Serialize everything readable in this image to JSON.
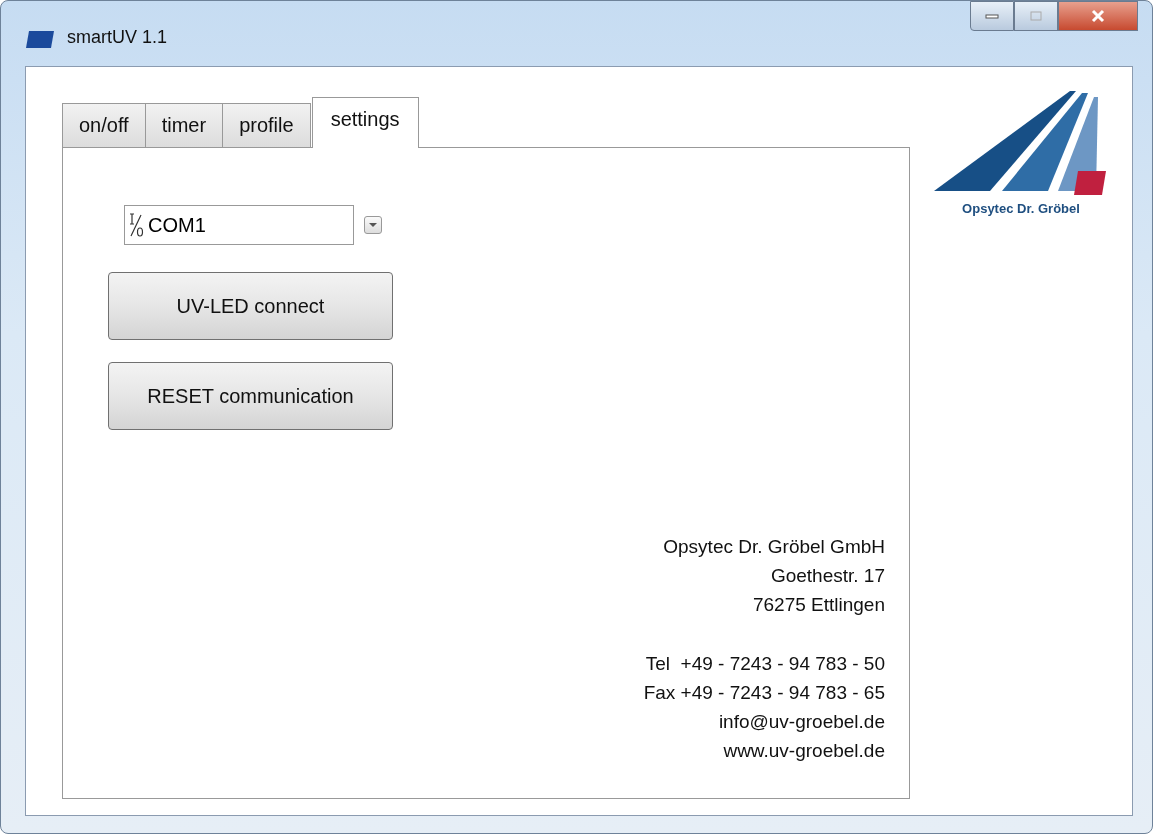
{
  "window": {
    "title": "smartUV 1.1"
  },
  "tabs": [
    {
      "label": "on/off",
      "selected": false
    },
    {
      "label": "timer",
      "selected": false
    },
    {
      "label": "profile",
      "selected": false
    },
    {
      "label": "settings",
      "selected": true
    }
  ],
  "port": {
    "value": "COM1"
  },
  "buttons": [
    "UV-LED connect",
    "RESET communication"
  ],
  "logo": {
    "text": "Opsytec Dr. Gröbel"
  },
  "address": [
    "Opsytec Dr. Gröbel GmbH",
    "Goethestr. 17",
    "76275 Ettlingen"
  ],
  "contact": [
    "Tel  +49 - 7243 - 94 783 - 50",
    "Fax +49 - 7243 - 94 783 - 65",
    "info@uv-groebel.de",
    "www.uv-groebel.de"
  ]
}
